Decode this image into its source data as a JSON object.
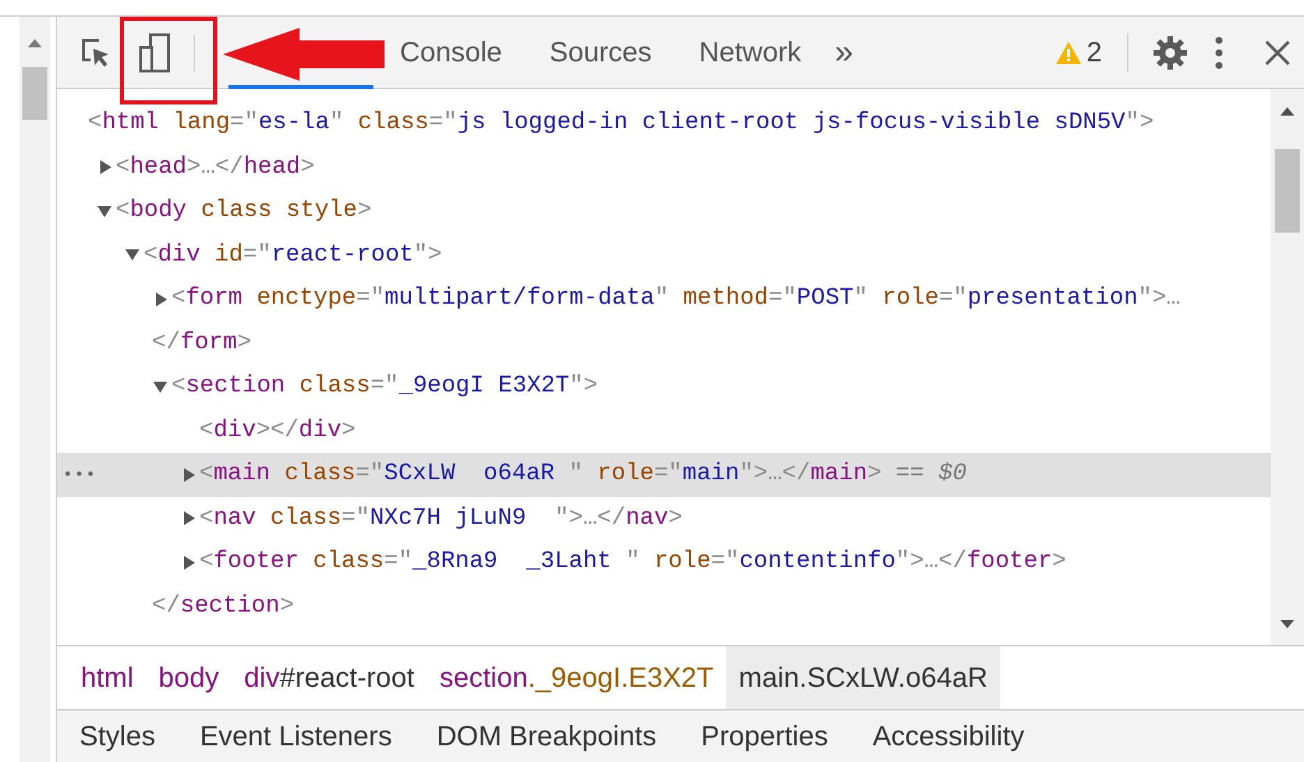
{
  "toolbar": {
    "tabs": [
      {
        "label": "Console",
        "selected": false
      },
      {
        "label": "Sources",
        "selected": false
      },
      {
        "label": "Network",
        "selected": false
      }
    ],
    "overflow": "»",
    "warning_count": "2"
  },
  "dom_tree": [
    {
      "kind": "node",
      "tokens": [
        {
          "kind": "punct",
          "text": "<"
        },
        {
          "kind": "tag",
          "text": "html"
        },
        {
          "kind": "attr",
          "text": " lang"
        },
        {
          "kind": "punct",
          "text": "=\""
        },
        {
          "kind": "val",
          "text": "es-la"
        },
        {
          "kind": "punct",
          "text": "\""
        },
        {
          "kind": "attr",
          "text": " class"
        },
        {
          "kind": "punct",
          "text": "=\""
        },
        {
          "kind": "val",
          "text": "js logged-in client-root js-focus-visible sDN5V"
        },
        {
          "kind": "punct",
          "text": "\">"
        }
      ],
      "selected": false,
      "children": [
        {
          "kind": "node",
          "expanded": false,
          "selected": false,
          "tokens": [
            {
              "kind": "punct",
              "text": "<"
            },
            {
              "kind": "tag",
              "text": "head"
            },
            {
              "kind": "punct",
              "text": ">…</"
            },
            {
              "kind": "tag",
              "text": "head"
            },
            {
              "kind": "punct",
              "text": ">"
            }
          ]
        },
        {
          "kind": "node",
          "expanded": true,
          "selected": false,
          "tokens": [
            {
              "kind": "punct",
              "text": "<"
            },
            {
              "kind": "tag",
              "text": "body"
            },
            {
              "kind": "attr",
              "text": " class style"
            },
            {
              "kind": "punct",
              "text": ">"
            }
          ],
          "children": [
            {
              "kind": "node",
              "expanded": true,
              "selected": false,
              "tokens": [
                {
                  "kind": "punct",
                  "text": "<"
                },
                {
                  "kind": "tag",
                  "text": "div"
                },
                {
                  "kind": "attr",
                  "text": " id"
                },
                {
                  "kind": "punct",
                  "text": "=\""
                },
                {
                  "kind": "val",
                  "text": "react-root"
                },
                {
                  "kind": "punct",
                  "text": "\">"
                }
              ],
              "children": [
                {
                  "kind": "node",
                  "expanded": false,
                  "selected": false,
                  "tokens": [
                    {
                      "kind": "punct",
                      "text": "<"
                    },
                    {
                      "kind": "tag",
                      "text": "form"
                    },
                    {
                      "kind": "attr",
                      "text": " enctype"
                    },
                    {
                      "kind": "punct",
                      "text": "=\""
                    },
                    {
                      "kind": "val",
                      "text": "multipart/form-data"
                    },
                    {
                      "kind": "punct",
                      "text": "\""
                    },
                    {
                      "kind": "attr",
                      "text": " method"
                    },
                    {
                      "kind": "punct",
                      "text": "=\""
                    },
                    {
                      "kind": "val",
                      "text": "POST"
                    },
                    {
                      "kind": "punct",
                      "text": "\""
                    },
                    {
                      "kind": "attr",
                      "text": " role"
                    },
                    {
                      "kind": "punct",
                      "text": "=\""
                    },
                    {
                      "kind": "val",
                      "text": "presentation"
                    },
                    {
                      "kind": "punct",
                      "text": "\">…"
                    }
                  ]
                },
                {
                  "kind": "close",
                  "tokens": [
                    {
                      "kind": "punct",
                      "text": "</"
                    },
                    {
                      "kind": "tag",
                      "text": "form"
                    },
                    {
                      "kind": "punct",
                      "text": ">"
                    }
                  ]
                },
                {
                  "kind": "node",
                  "expanded": true,
                  "selected": false,
                  "tokens": [
                    {
                      "kind": "punct",
                      "text": "<"
                    },
                    {
                      "kind": "tag",
                      "text": "section"
                    },
                    {
                      "kind": "attr",
                      "text": " class"
                    },
                    {
                      "kind": "punct",
                      "text": "=\""
                    },
                    {
                      "kind": "val",
                      "text": "_9eogI E3X2T"
                    },
                    {
                      "kind": "punct",
                      "text": "\">"
                    }
                  ],
                  "children": [
                    {
                      "kind": "node",
                      "selected": false,
                      "tokens": [
                        {
                          "kind": "punct",
                          "text": "<"
                        },
                        {
                          "kind": "tag",
                          "text": "div"
                        },
                        {
                          "kind": "punct",
                          "text": "></"
                        },
                        {
                          "kind": "tag",
                          "text": "div"
                        },
                        {
                          "kind": "punct",
                          "text": ">"
                        }
                      ]
                    },
                    {
                      "kind": "node",
                      "expanded": false,
                      "selected": true,
                      "gutter": "•••",
                      "tokens": [
                        {
                          "kind": "punct",
                          "text": "<"
                        },
                        {
                          "kind": "tag",
                          "text": "main"
                        },
                        {
                          "kind": "attr",
                          "text": " class"
                        },
                        {
                          "kind": "punct",
                          "text": "=\""
                        },
                        {
                          "kind": "val",
                          "text": "SCxLW  o64aR "
                        },
                        {
                          "kind": "punct",
                          "text": "\""
                        },
                        {
                          "kind": "attr",
                          "text": " role"
                        },
                        {
                          "kind": "punct",
                          "text": "=\""
                        },
                        {
                          "kind": "val",
                          "text": "main"
                        },
                        {
                          "kind": "punct",
                          "text": "\">…</"
                        },
                        {
                          "kind": "tag",
                          "text": "main"
                        },
                        {
                          "kind": "punct",
                          "text": ">"
                        },
                        {
                          "kind": "ref",
                          "text": " == $0"
                        }
                      ]
                    },
                    {
                      "kind": "node",
                      "expanded": false,
                      "selected": false,
                      "tokens": [
                        {
                          "kind": "punct",
                          "text": "<"
                        },
                        {
                          "kind": "tag",
                          "text": "nav"
                        },
                        {
                          "kind": "attr",
                          "text": " class"
                        },
                        {
                          "kind": "punct",
                          "text": "=\""
                        },
                        {
                          "kind": "val",
                          "text": "NXc7H jLuN9  "
                        },
                        {
                          "kind": "punct",
                          "text": "\">…</"
                        },
                        {
                          "kind": "tag",
                          "text": "nav"
                        },
                        {
                          "kind": "punct",
                          "text": ">"
                        }
                      ]
                    },
                    {
                      "kind": "node",
                      "expanded": false,
                      "selected": false,
                      "tokens": [
                        {
                          "kind": "punct",
                          "text": "<"
                        },
                        {
                          "kind": "tag",
                          "text": "footer"
                        },
                        {
                          "kind": "attr",
                          "text": " class"
                        },
                        {
                          "kind": "punct",
                          "text": "=\""
                        },
                        {
                          "kind": "val",
                          "text": "_8Rna9  _3Laht "
                        },
                        {
                          "kind": "punct",
                          "text": "\""
                        },
                        {
                          "kind": "attr",
                          "text": " role"
                        },
                        {
                          "kind": "punct",
                          "text": "=\""
                        },
                        {
                          "kind": "val",
                          "text": "contentinfo"
                        },
                        {
                          "kind": "punct",
                          "text": "\">…</"
                        },
                        {
                          "kind": "tag",
                          "text": "footer"
                        },
                        {
                          "kind": "punct",
                          "text": ">"
                        }
                      ]
                    }
                  ]
                },
                {
                  "kind": "close",
                  "tokens": [
                    {
                      "kind": "punct",
                      "text": "</"
                    },
                    {
                      "kind": "tag",
                      "text": "section"
                    },
                    {
                      "kind": "punct",
                      "text": ">"
                    }
                  ]
                }
              ]
            }
          ]
        }
      ]
    }
  ],
  "breadcrumbs": [
    {
      "selected": false,
      "parts": [
        {
          "kind": "tag",
          "text": "html"
        }
      ]
    },
    {
      "selected": false,
      "parts": [
        {
          "kind": "tag",
          "text": "body"
        }
      ]
    },
    {
      "selected": false,
      "parts": [
        {
          "kind": "tag",
          "text": "div"
        },
        {
          "kind": "id",
          "text": "#react-root"
        }
      ]
    },
    {
      "selected": false,
      "parts": [
        {
          "kind": "tag",
          "text": "section"
        },
        {
          "kind": "class",
          "text": "._9eogI.E3X2T"
        }
      ]
    },
    {
      "selected": true,
      "parts": [
        {
          "kind": "tag",
          "text": "main"
        },
        {
          "kind": "class",
          "text": ".SCxLW.o64aR"
        }
      ]
    }
  ],
  "bottom_tabs": [
    "Styles",
    "Event Listeners",
    "DOM Breakpoints",
    "Properties",
    "Accessibility"
  ]
}
